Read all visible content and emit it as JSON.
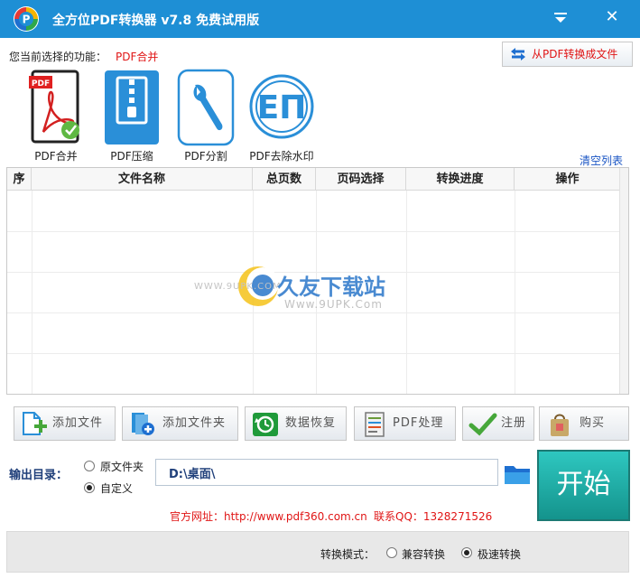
{
  "window": {
    "title": "全方位PDF转换器 v7.8 免费试用版",
    "min_glyph": "▼",
    "close_glyph": "✕"
  },
  "function": {
    "label": "您当前选择的功能：",
    "value": "PDF合并"
  },
  "reverse_button": {
    "label": "从PDF转换成文件",
    "icon": "swap-arrows-icon"
  },
  "tools": [
    {
      "label": "PDF合并",
      "icon": "pdf-merge-icon"
    },
    {
      "label": "PDF压缩",
      "icon": "zip-compress-icon"
    },
    {
      "label": "PDF分割",
      "icon": "wrench-icon"
    },
    {
      "label": "PDF去除水印",
      "icon": "watermark-remove-icon",
      "glyph": "EΠ"
    }
  ],
  "clear_link": "清空列表",
  "table": {
    "columns": [
      "序",
      "文件名称",
      "总页数",
      "页码选择",
      "转换进度",
      "操作"
    ],
    "rows": []
  },
  "watermark": {
    "url1": "WWW.9UPK.COM",
    "name": "久友下载站",
    "url2": "Www.9UPK.Com"
  },
  "actions": [
    {
      "label": "添加文件",
      "icon": "add-file-icon"
    },
    {
      "label": "添加文件夹",
      "icon": "add-folder-icon"
    },
    {
      "label": "数据恢复",
      "icon": "data-recovery-icon"
    },
    {
      "label": "PDF处理",
      "icon": "pdf-process-icon"
    },
    {
      "label": "注册",
      "icon": "checkmark-icon"
    },
    {
      "label": "购买",
      "icon": "shopping-bag-icon"
    }
  ],
  "output": {
    "label": "输出目录：",
    "option_source": "原文件夹",
    "option_custom": "自定义",
    "selected": "自定义",
    "path": "D:\\桌面\\"
  },
  "start_label": "开始",
  "contact": {
    "site": "官方网址：http://www.pdf360.com.cn",
    "qq": "联系QQ：1328271526"
  },
  "mode": {
    "label": "转换模式：",
    "compat": "兼容转换",
    "fast": "极速转换",
    "selected": "极速转换"
  },
  "colors": {
    "titlebar": "#1e8fd5",
    "accent_red": "#e01515",
    "start_button": "#1fb0a9",
    "link_blue": "#1a55c4"
  }
}
